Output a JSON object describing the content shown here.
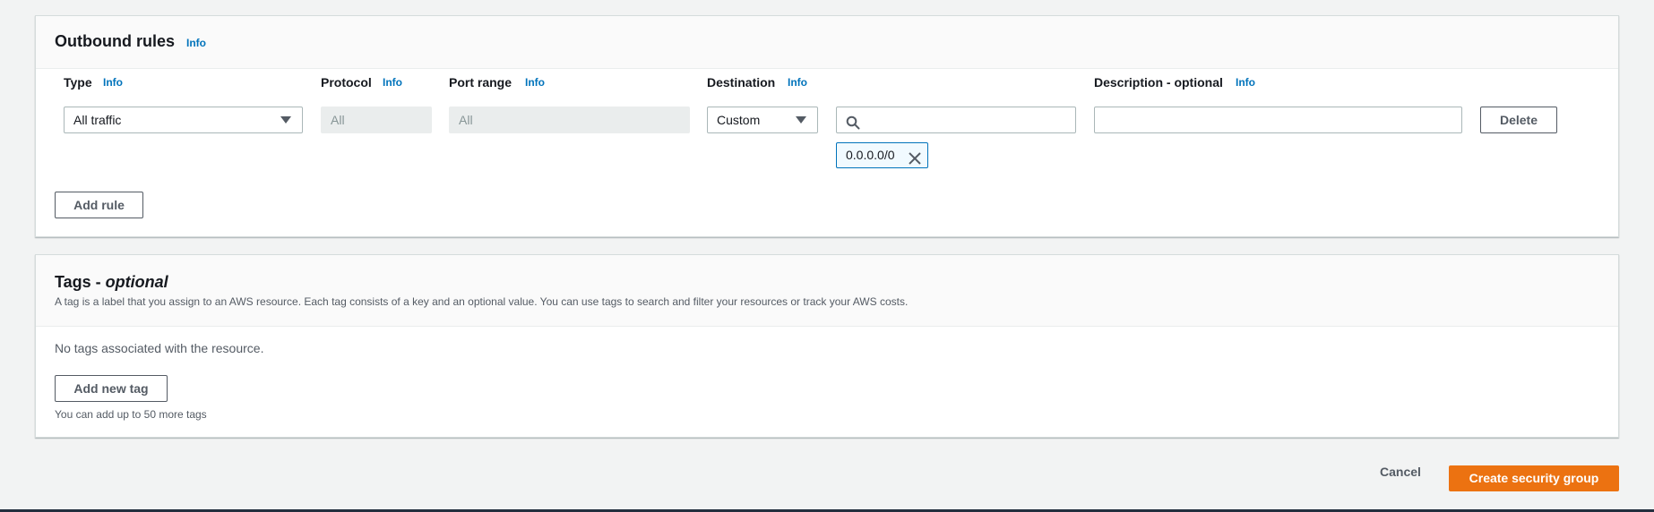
{
  "outbound": {
    "title": "Outbound rules",
    "info": "Info",
    "columns": {
      "type": "Type",
      "protocol": "Protocol",
      "port_range": "Port range",
      "destination": "Destination",
      "description": "Description - optional"
    },
    "rule": {
      "type_value": "All traffic",
      "protocol_value": "All",
      "port_value": "All",
      "destination_value": "Custom",
      "cidr_search_value": "",
      "description_value": "",
      "token": "0.0.0.0/0",
      "delete_label": "Delete"
    },
    "add_rule_label": "Add rule"
  },
  "tags": {
    "title": "Tags - ",
    "title_italic": "optional",
    "description": "A tag is a label that you assign to an AWS resource. Each tag consists of a key and an optional value. You can use tags to search and filter your resources or track your AWS costs.",
    "empty_text": "No tags associated with the resource.",
    "add_tag_label": "Add new tag",
    "limit_text": "You can add up to 50 more tags"
  },
  "footer": {
    "cancel_label": "Cancel",
    "create_label": "Create security group"
  },
  "colors": {
    "primary": "#ec7211",
    "link": "#0073bb"
  }
}
